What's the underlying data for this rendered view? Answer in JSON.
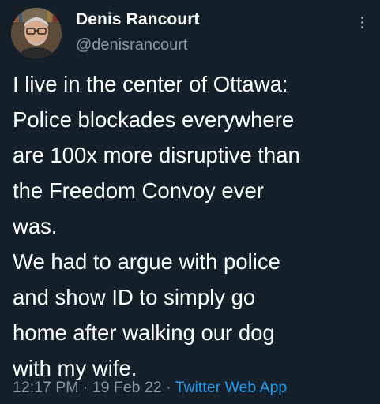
{
  "author": {
    "display_name": "Denis Rancourt",
    "handle": "@denisrancourt"
  },
  "tweet": {
    "lines": [
      "I live in the center of Ottawa:",
      "Police blockades everywhere",
      "are 100x more disruptive than",
      "the Freedom Convoy ever",
      "was.",
      "We had to argue with police",
      "and show ID to simply go",
      "home after walking our dog",
      "with my wife."
    ]
  },
  "meta": {
    "time": "12:17 PM",
    "separator": "·",
    "date": "19 Feb 22",
    "app": "Twitter Web App"
  },
  "icons": {
    "more": "more-options-icon",
    "avatar": "avatar"
  },
  "colors": {
    "background": "#15202b",
    "text_primary": "#ffffff",
    "text_secondary": "#8b98a5",
    "link": "#1d9bf0"
  }
}
